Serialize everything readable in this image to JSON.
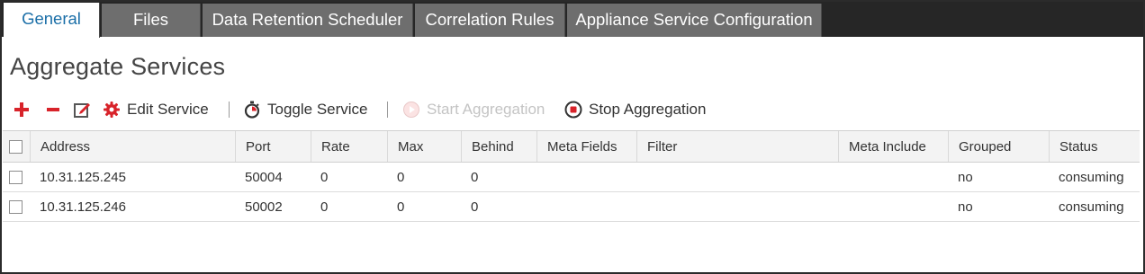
{
  "tabs": [
    {
      "label": "General",
      "active": true
    },
    {
      "label": "Files",
      "active": false
    },
    {
      "label": "Data Retention Scheduler",
      "active": false
    },
    {
      "label": "Correlation Rules",
      "active": false
    },
    {
      "label": "Appliance Service Configuration",
      "active": false
    }
  ],
  "page": {
    "title": "Aggregate Services"
  },
  "toolbar": {
    "add_icon": "plus-icon",
    "remove_icon": "minus-icon",
    "edit_icon": "edit-icon",
    "edit_service_icon": "gear-icon",
    "edit_service_label": "Edit Service",
    "toggle_service_icon": "stopwatch-icon",
    "toggle_service_label": "Toggle Service",
    "start_aggregation_icon": "play-icon",
    "start_aggregation_label": "Start Aggregation",
    "start_aggregation_enabled": false,
    "stop_aggregation_icon": "stop-icon",
    "stop_aggregation_label": "Stop Aggregation"
  },
  "colors": {
    "tab_active_text": "#1b6fa8",
    "tab_inactive_bg": "#6e6e6e",
    "tab_bar_bg": "#262626",
    "toolbar_red": "#d8232a",
    "disabled_text": "#c4c4c4"
  },
  "table": {
    "columns": [
      "Address",
      "Port",
      "Rate",
      "Max",
      "Behind",
      "Meta Fields",
      "Filter",
      "Meta Include",
      "Grouped",
      "Status"
    ],
    "rows": [
      {
        "address": "10.31.125.245",
        "port": "50004",
        "rate": "0",
        "max": "0",
        "behind": "0",
        "meta_fields": "",
        "filter": "",
        "meta_include": "",
        "grouped": "no",
        "status": "consuming"
      },
      {
        "address": "10.31.125.246",
        "port": "50002",
        "rate": "0",
        "max": "0",
        "behind": "0",
        "meta_fields": "",
        "filter": "",
        "meta_include": "",
        "grouped": "no",
        "status": "consuming"
      }
    ]
  }
}
